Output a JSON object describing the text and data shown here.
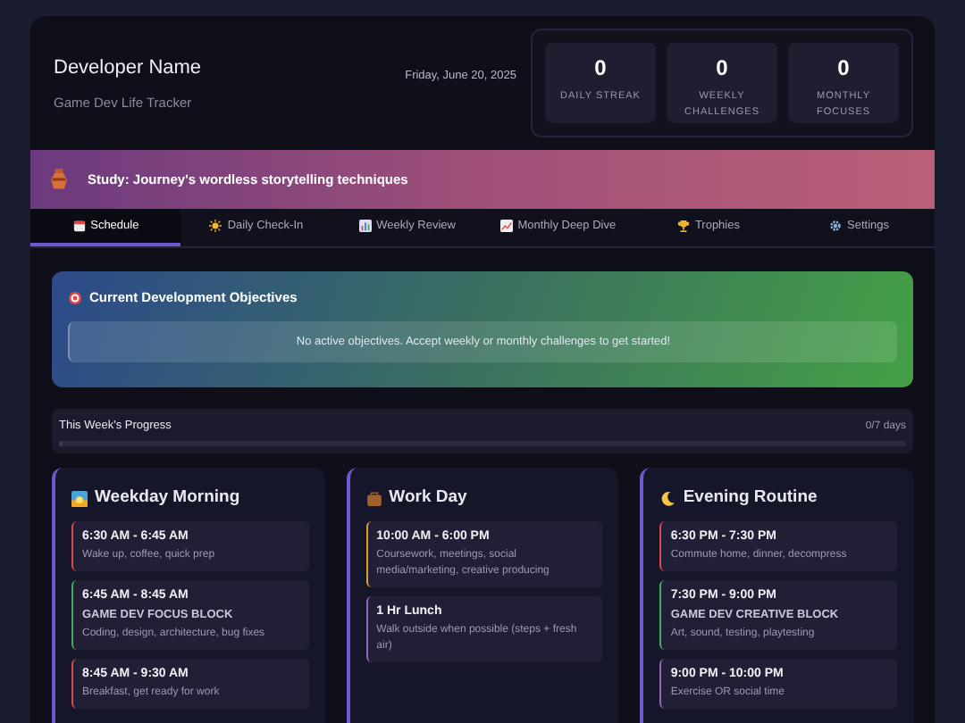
{
  "header": {
    "name": "Developer Name",
    "subtitle": "Game Dev Life Tracker",
    "date": "Friday, June 20, 2025",
    "stats": [
      {
        "value": "0",
        "label": "DAILY STREAK"
      },
      {
        "value": "0",
        "label": "WEEKLY CHALLENGES"
      },
      {
        "value": "0",
        "label": "MONTHLY FOCUSES"
      }
    ]
  },
  "banner": {
    "text": "Study: Journey's wordless storytelling techniques"
  },
  "tabs": [
    {
      "label": "Schedule",
      "selected": true
    },
    {
      "label": "Daily Check-In",
      "selected": false
    },
    {
      "label": "Weekly Review",
      "selected": false
    },
    {
      "label": "Monthly Deep Dive",
      "selected": false
    },
    {
      "label": "Trophies",
      "selected": false
    },
    {
      "label": "Settings",
      "selected": false
    }
  ],
  "objectives": {
    "title": "Current Development Objectives",
    "empty_message": "No active objectives. Accept weekly or monthly challenges to get started!"
  },
  "progress": {
    "title": "This Week's Progress",
    "reading": "0/7 days",
    "level": 0
  },
  "schedule": [
    {
      "title": "Weekday Morning",
      "blocks": [
        {
          "time": "6:30 AM - 6:45 AM",
          "description": "Wake up, coffee, quick prep",
          "color": "#dc4a4a"
        },
        {
          "time": "6:45 AM - 8:45 AM",
          "heading": "GAME DEV FOCUS BLOCK",
          "description": "Coding, design, architecture, bug fixes",
          "color": "#3fae5f"
        },
        {
          "time": "8:45 AM - 9:30 AM",
          "description": "Breakfast, get ready for work",
          "color": "#dc4a4a"
        }
      ]
    },
    {
      "title": "Work Day",
      "blocks": [
        {
          "time": "10:00 AM - 6:00 PM",
          "description": "Coursework, meetings, social media/marketing, creative producing",
          "color": "#e0a030"
        },
        {
          "time": "1 Hr Lunch",
          "description": "Walk outside when possible (steps + fresh air)",
          "color": "#9b5fc0"
        }
      ]
    },
    {
      "title": "Evening Routine",
      "blocks": [
        {
          "time": "6:30 PM - 7:30 PM",
          "description": "Commute home, dinner, decompress",
          "color": "#dc4a4a"
        },
        {
          "time": "7:30 PM - 9:00 PM",
          "heading": "GAME DEV CREATIVE BLOCK",
          "description": "Art, sound, testing, playtesting",
          "color": "#3fae5f"
        },
        {
          "time": "9:00 PM - 10:00 PM",
          "description": "Exercise OR social time",
          "color": "#9b5fc0"
        }
      ]
    }
  ]
}
